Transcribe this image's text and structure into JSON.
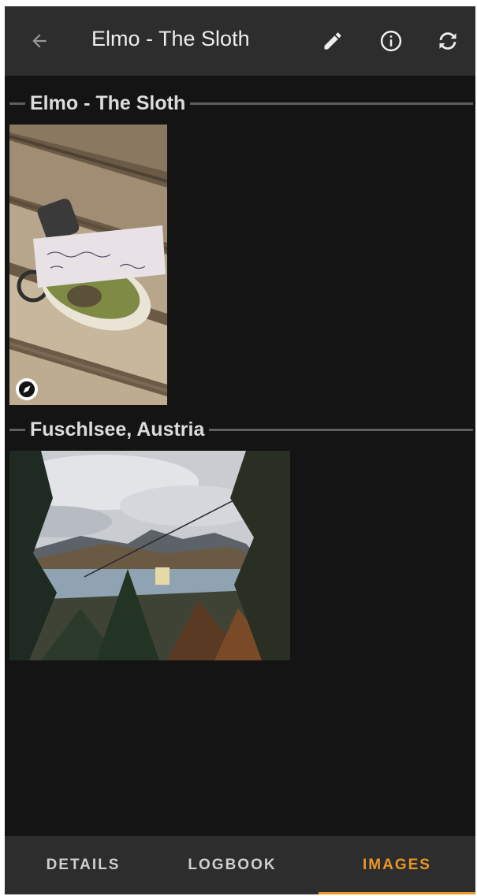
{
  "appbar": {
    "title": "Elmo - The Sloth",
    "icons": [
      "arrow-back-icon",
      "pencil-icon",
      "info-icon",
      "sync-icon"
    ]
  },
  "sections": [
    {
      "label": "Elmo - The Sloth",
      "images": [
        {
          "description_icon": "compass-icon"
        }
      ]
    },
    {
      "label": "Fuschlsee, Austria",
      "images": [
        {}
      ]
    }
  ],
  "tabs": [
    {
      "label": "DETAILS",
      "active": false
    },
    {
      "label": "LOGBOOK",
      "active": false
    },
    {
      "label": "IMAGES",
      "active": true
    }
  ],
  "colors": {
    "background": "#141414",
    "bar": "#2d2d2d",
    "accent": "#e8962a",
    "text": "#eeeeee"
  }
}
